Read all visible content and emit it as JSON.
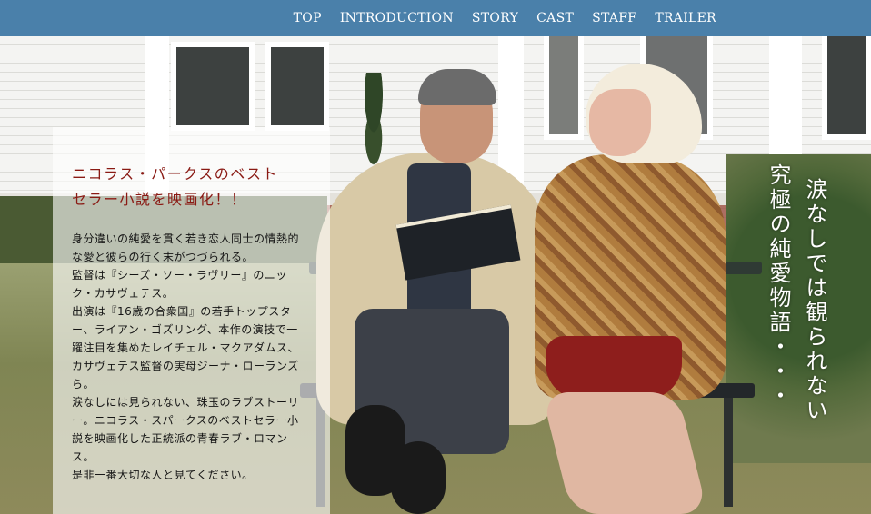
{
  "nav": {
    "items": [
      "TOP",
      "INTRODUCTION",
      "STORY",
      "CAST",
      "STAFF",
      "TRAILER"
    ]
  },
  "intro": {
    "headline": [
      "ニコラス・パークスのベスト",
      "セラー小説を映画化！！"
    ],
    "body_lines": [
      "身分違いの純愛を貫く若き恋人同士の情熱的",
      "な愛と彼らの行く末がつづられる。",
      "監督は『シーズ・ソー・ラヴリー』のニッ",
      "ク・カサヴェテス。",
      "出演は『16歳の合衆国』の若手トップスタ",
      "ー、ライアン・ゴズリング、本作の演技で一",
      "躍注目を集めたレイチェル・マクアダムス、",
      "カサヴェテス監督の実母ジーナ・ローランズ",
      "ら。",
      "涙なしには見られない、珠玉のラブストーリ",
      "ー。ニコラス・スパークスのベストセラー小",
      "説を映画化した正統派の青春ラブ・ロマン",
      "ス。",
      "是非一番大切な人と見てください。"
    ]
  },
  "tagline": {
    "line1": "涙なしでは観られない",
    "line2": "究極の純愛物語・・・"
  },
  "colors": {
    "nav_bg": "#4a80aa",
    "headline": "#8a1a14"
  }
}
